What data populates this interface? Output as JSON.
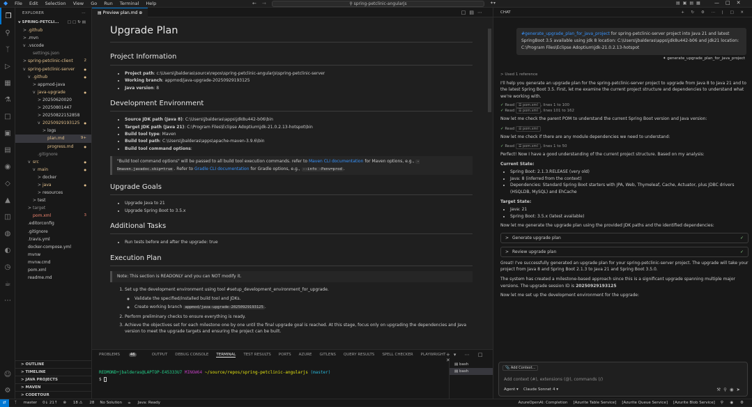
{
  "titlebar": {
    "menus": [
      "File",
      "Edit",
      "Selection",
      "View",
      "Go",
      "Run",
      "Terminal",
      "Help"
    ],
    "search": "spring-petclinic-angularjs"
  },
  "explorer": {
    "header": "EXPLORER",
    "root": "SPRING-PETCLI...",
    "rows": [
      {
        "label": ".github",
        "indent": 1,
        "arrow": ">",
        "cls": "gold",
        "badge": "",
        "dot": false
      },
      {
        "label": ".mvn",
        "indent": 1,
        "arrow": ">",
        "cls": "",
        "badge": "",
        "dot": false
      },
      {
        "label": ".vscode",
        "indent": 1,
        "arrow": "v",
        "cls": "",
        "badge": "",
        "dot": false
      },
      {
        "label": "settings.json",
        "indent": 2,
        "arrow": "",
        "cls": "grey",
        "badge": "",
        "dot": false
      },
      {
        "label": "spring-petclinic-client",
        "indent": 1,
        "arrow": ">",
        "cls": "gold",
        "badge": "2",
        "bcls": "gold"
      },
      {
        "label": "spring-petclinic-server",
        "indent": 1,
        "arrow": "v",
        "cls": "gold",
        "badge": "",
        "dot": true
      },
      {
        "label": ".github",
        "indent": 2,
        "arrow": "v",
        "cls": "gold",
        "badge": "",
        "dot": true
      },
      {
        "label": "appmod-java",
        "indent": 3,
        "arrow": ">",
        "cls": "",
        "badge": "",
        "dot": false
      },
      {
        "label": "java-upgrade",
        "indent": 3,
        "arrow": "v",
        "cls": "gold",
        "badge": "",
        "dot": true
      },
      {
        "label": "20250620020",
        "indent": 4,
        "arrow": ">",
        "cls": "",
        "badge": "",
        "dot": false
      },
      {
        "label": "20250801447",
        "indent": 4,
        "arrow": ">",
        "cls": "",
        "badge": "",
        "dot": false
      },
      {
        "label": "20250822152858",
        "indent": 4,
        "arrow": ">",
        "cls": "",
        "badge": "",
        "dot": false
      },
      {
        "label": "20250929193125",
        "indent": 4,
        "arrow": "v",
        "cls": "gold",
        "badge": "",
        "dot": true
      },
      {
        "label": "logs",
        "indent": 5,
        "arrow": ">",
        "cls": "",
        "badge": "",
        "dot": false
      },
      {
        "label": "plan.md",
        "indent": 5,
        "arrow": "",
        "cls": "gold",
        "badge": "9+",
        "bcls": "gold",
        "sel": true
      },
      {
        "label": "progress.md",
        "indent": 5,
        "arrow": "",
        "cls": "gold",
        "badge": "",
        "dot": true
      },
      {
        "label": ".gitignore",
        "indent": 3,
        "arrow": "",
        "cls": "grey",
        "badge": "",
        "dot": false
      },
      {
        "label": "src",
        "indent": 2,
        "arrow": "v",
        "cls": "gold",
        "badge": "",
        "dot": true
      },
      {
        "label": "main",
        "indent": 3,
        "arrow": "v",
        "cls": "gold",
        "badge": "",
        "dot": true
      },
      {
        "label": "docker",
        "indent": 4,
        "arrow": ">",
        "cls": "",
        "badge": "",
        "dot": false
      },
      {
        "label": "java",
        "indent": 4,
        "arrow": ">",
        "cls": "gold",
        "badge": "",
        "dot": true
      },
      {
        "label": "resources",
        "indent": 4,
        "arrow": ">",
        "cls": "",
        "badge": "",
        "dot": false
      },
      {
        "label": "test",
        "indent": 3,
        "arrow": ">",
        "cls": "",
        "badge": "",
        "dot": false
      },
      {
        "label": "target",
        "indent": 2,
        "arrow": ">",
        "cls": "grey",
        "badge": "",
        "dot": false
      },
      {
        "label": "pom.xml",
        "indent": 2,
        "arrow": "",
        "cls": "red",
        "badge": "3",
        "bcls": "red"
      },
      {
        "label": ".editorconfig",
        "indent": 1,
        "arrow": "",
        "cls": "",
        "badge": "",
        "dot": false
      },
      {
        "label": ".gitignore",
        "indent": 1,
        "arrow": "",
        "cls": "",
        "badge": "",
        "dot": false
      },
      {
        "label": ".travis.yml",
        "indent": 1,
        "arrow": "",
        "cls": "",
        "badge": "",
        "dot": false
      },
      {
        "label": "docker-compose.yml",
        "indent": 1,
        "arrow": "",
        "cls": "",
        "badge": "",
        "dot": false
      },
      {
        "label": "mvnw",
        "indent": 1,
        "arrow": "",
        "cls": "",
        "badge": "",
        "dot": false
      },
      {
        "label": "mvnw.cmd",
        "indent": 1,
        "arrow": "",
        "cls": "",
        "badge": "",
        "dot": false
      },
      {
        "label": "pom.xml",
        "indent": 1,
        "arrow": "",
        "cls": "",
        "badge": "",
        "dot": false
      },
      {
        "label": "readme.md",
        "indent": 1,
        "arrow": "",
        "cls": "",
        "badge": "",
        "dot": false
      }
    ],
    "footer": [
      "OUTLINE",
      "TIMELINE",
      "JAVA PROJECTS",
      "MAVEN",
      "CODETOUR"
    ]
  },
  "editor": {
    "tab": "Preview plan.md",
    "title": "Upgrade Plan",
    "h_project": "Project Information",
    "project": [
      {
        "k": "Project path",
        "v": ": c:\\Users\\jbalderas\\source\\repos\\spring-petclinic-angularjs\\spring-petclinic-server"
      },
      {
        "k": "Working branch",
        "v": ": appmod/java-upgrade-20250929193125"
      },
      {
        "k": "Java version",
        "v": ": 8"
      }
    ],
    "h_dev": "Development Environment",
    "dev": [
      {
        "k": "Source JDK path (Java 8)",
        "v": ": C:\\Users\\jbalderas\\apps\\jdk8u442-b06\\bin"
      },
      {
        "k": "Target JDK path (Java 21)",
        "v": ": C:\\Program Files\\Eclipse Adoptium\\jdk-21.0.2.13-hotspot\\bin"
      },
      {
        "k": "Build tool type",
        "v": ": Maven"
      },
      {
        "k": "Build tool path",
        "v": ": C:\\Users\\jbalderas\\apps\\apache-maven-3.9.6\\bin"
      },
      {
        "k": "Build tool command options",
        "v": ":"
      }
    ],
    "note1_a": "\"Build tool command options\" will be passed to all build tool execution commands. refer to ",
    "note1_link1": "Maven CLI documentation",
    "note1_b": " for Maven options, e.g., ",
    "note1_code1": "-Dmaven.javadoc.skip=true",
    "note1_c": ". Refer to ",
    "note1_link2": "Gradle CLI documentation",
    "note1_d": " for Gradle options, e.g., ",
    "note1_code2": "--info -Penv=prod",
    "note1_e": ".",
    "h_goals": "Upgrade Goals",
    "goals": [
      "Upgrade Java to 21",
      "Upgrade Spring Boot to 3.5.x"
    ],
    "h_tasks": "Additional Tasks",
    "tasks": [
      "Run tests before and after the upgrade: true"
    ],
    "h_exec": "Execution Plan",
    "note2": "Note: This section is READONLY and you can NOT modify it.",
    "exec1": "Set up the development environment using tool #setup_development_environment_for_upgrade.",
    "exec1_sub1": "Validate the specified/installed build tool and JDKs.",
    "exec1_sub2_a": "Create working branch ",
    "exec1_sub2_code": "appmod/java-upgrade-20250929193125",
    "exec1_sub2_b": ".",
    "exec2": "Perform preliminary checks to ensure everything is ready.",
    "exec3": "Achieve the objectives set for each milestone one by one until the final upgrade goal is reached. At this stage, focus only on upgrading the dependencies and Java version to meet the upgrade targets and ensuring the project can be built."
  },
  "panel": {
    "tabs": [
      "PROBLEMS",
      "OUTPUT",
      "DEBUG CONSOLE",
      "TERMINAL",
      "TEST RESULTS",
      "PORTS",
      "AZURE",
      "GITLENS",
      "QUERY RESULTS",
      "SPELL CHECKER",
      "PLAYWRIGHT"
    ],
    "problems_count": "46",
    "prompt_user": "REDMOND+jbalderas@LAPTOP-E45333U7",
    "prompt_env": "MINGW64",
    "prompt_path": "~/source/repos/spring-petclinic-angularjs",
    "prompt_branch": "(master)",
    "prompt_char": "$",
    "terminals": [
      "bash",
      "bash"
    ]
  },
  "chat": {
    "header": "CHAT",
    "user_tag": "#generate_upgrade_plan_for_java_project",
    "user_msg": " for spring-petclinic-server project into Java 21 and latest SpringBoot 3.5 available using jdk 8 location: C:\\Users\\jbalderas\\apps\\jdk8u442-b06 and jdk21 location: C:\\Program Files\\Eclipse Adoptium\\jdk-21.0.2.13-hotspot",
    "tool_ref": "generate_upgrade_plan_for_java_project",
    "used_ref": "Used 1 reference",
    "intro": "I'll help you generate an upgrade plan for the spring-petclinic-server project to upgrade from Java 8 to Java 21 and to the latest Spring Boot 3.5. First, let me examine the current project structure and dependencies to understand what we're working with.",
    "read1": "pom.xml",
    "read1_lines": ", lines 1 to 100",
    "read2": "pom.xml",
    "read2_lines": ", lines 101 to 162",
    "msg2": "Now let me check the parent POM to understand the current Spring Boot version and Java version:",
    "read3": "pom.xml",
    "msg3": "Now let me check if there are any module dependencies we need to understand:",
    "read4": "pom.xml",
    "read4_lines": ", lines 1 to 50",
    "read_label": "Read",
    "msg4": "Perfect! Now I have a good understanding of the current project structure. Based on my analysis:",
    "current_title": "Current State:",
    "current": [
      "Spring Boot: 2.1.3.RELEASE (very old)",
      "Java: 8 (inferred from the context)",
      "Dependencies: Standard Spring Boot starters with JPA, Web, Thymeleaf, Cache, Actuator, plus JDBC drivers (HSQLDB, MySQL) and EhCache"
    ],
    "target_title": "Target State:",
    "target": [
      "Java: 21",
      "Spring Boot: 3.5.x (latest available)"
    ],
    "msg5": "Now let me generate the upgrade plan using the provided JDK paths and the identified dependencies:",
    "step1": "Generate upgrade plan",
    "step2": "Review upgrade plan",
    "msg6": "Great! I've successfully generated an upgrade plan for your spring-petclinic-server project. The upgrade will take your project from Java 8 and Spring Boot 2.1.3 to Java 21 and Spring Boot 3.5.0.",
    "msg7_a": "The system has created a milestone-based approach since this is a significant upgrade spanning multiple major versions. The upgrade session ID is ",
    "msg7_id": "20250929193125",
    "msg8": "Now let me set up the development environment for the upgrade:",
    "add_context": "Add Context...",
    "input_placeholder": "Add context (#), extensions (@), commands (/)",
    "mode": "Agent",
    "model": "Claude Sonnet 4"
  },
  "status": {
    "branch": "master",
    "sync": "0↓ 21↑",
    "errors": "18",
    "warnings": "28",
    "solution": "No Solution",
    "java": "Java: Ready",
    "right": [
      "AzureOpenAI: Completion",
      "[Azurite Table Service]",
      "[Azurite Queue Service]",
      "[Azurite Blob Service]"
    ]
  },
  "colors": {
    "accent": "#0078d4",
    "link": "#3794ff",
    "modified": "#e2c08d",
    "error": "#f48771"
  }
}
